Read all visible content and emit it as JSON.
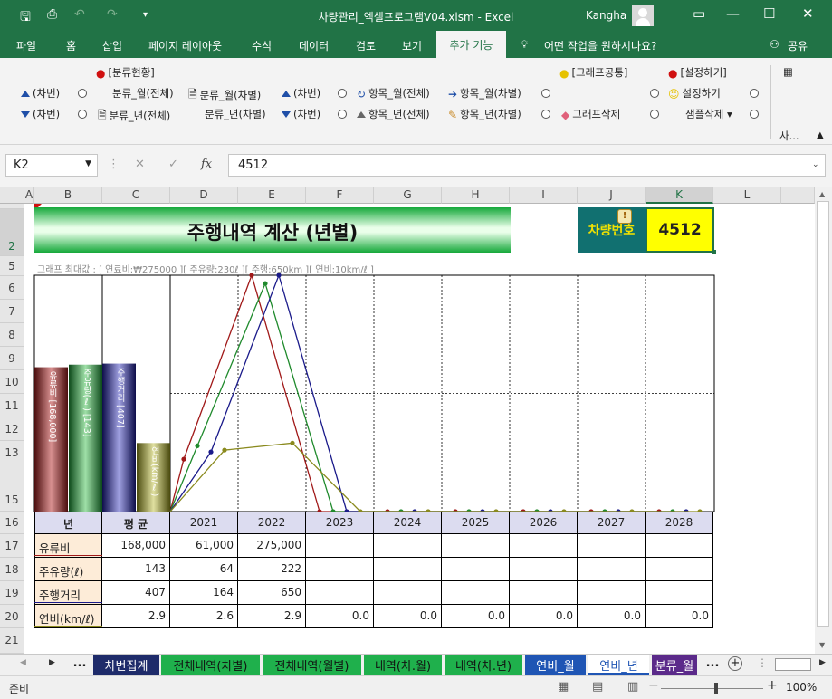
{
  "window": {
    "title": "차량관리_엑셀프로그램V04.xlsm  -  Excel",
    "user": "Kangha"
  },
  "ribbon_tabs": [
    "파일",
    "홈",
    "삽입",
    "페이지 레이아웃",
    "수식",
    "데이터",
    "검토",
    "보기",
    "추가 기능"
  ],
  "tell_me": "어떤 작업을 원하시나요?",
  "share": "공유",
  "ribbon": {
    "group1_title": "[분류현황]",
    "group2_title": "[그래프공통]",
    "group3_title": "[설정하기]",
    "col1": [
      "(차번)",
      "(차번)"
    ],
    "col2": [
      "분류_월(전체)",
      "분류_년(전체)"
    ],
    "col3": [
      "분류_월(차별)",
      "분류_년(차별)"
    ],
    "col4": [
      "(차번)",
      "(차번)"
    ],
    "col5": [
      "항목_월(전체)",
      "항목_년(전체)"
    ],
    "col6": [
      "항목_월(차별)",
      "항목_년(차별)"
    ],
    "col7": [
      "그래프삭제"
    ],
    "col8": [
      "설정하기",
      "샘플삭제"
    ],
    "collapsed": "사..."
  },
  "formula_bar": {
    "cell_ref": "K2",
    "fx": "fx",
    "value": "4512"
  },
  "columns": [
    "A",
    "B",
    "C",
    "D",
    "E",
    "F",
    "G",
    "H",
    "I",
    "J",
    "K",
    "L"
  ],
  "rows": [
    "1",
    "2",
    "5",
    "6",
    "7",
    "8",
    "9",
    "10",
    "11",
    "12",
    "13",
    "15",
    "16",
    "17",
    "18",
    "19",
    "20",
    "21"
  ],
  "sheet": {
    "title": "주행내역 계산 (년별)",
    "car_label": "차량번호",
    "car_number": "4512",
    "graph_note": "그래프 최대값 : [ 연료비:₩275000 ][ 주유량:230ℓ ][ 주행:650km ][ 연비:10km/ℓ ]",
    "bar_labels": [
      "유류비 [168,000]",
      "주유량(ℓ) [143]",
      "주행거리 [407]",
      "연비(km/ℓ)"
    ],
    "table_header": [
      "년",
      "평 균",
      "2021",
      "2022",
      "2023",
      "2024",
      "2025",
      "2026",
      "2027",
      "2028"
    ],
    "table_rows": [
      {
        "label": "유류비",
        "avg": "168,000",
        "vals": [
          "61,000",
          "275,000",
          "",
          "",
          "",
          "",
          "",
          ""
        ]
      },
      {
        "label": "주유량(ℓ)",
        "avg": "143",
        "vals": [
          "64",
          "222",
          "",
          "",
          "",
          "",
          "",
          ""
        ]
      },
      {
        "label": "주행거리",
        "avg": "407",
        "vals": [
          "164",
          "650",
          "",
          "",
          "",
          "",
          "",
          ""
        ]
      },
      {
        "label": "연비(km/ℓ)",
        "avg": "2.9",
        "vals": [
          "2.6",
          "2.9",
          "0.0",
          "0.0",
          "0.0",
          "0.0",
          "0.0",
          "0.0"
        ]
      }
    ]
  },
  "chart_data": {
    "type": "line",
    "categories": [
      "2021",
      "2022",
      "2023",
      "2024",
      "2025",
      "2026",
      "2027",
      "2028"
    ],
    "ylim": [
      0,
      1
    ],
    "series": [
      {
        "name": "유류비",
        "color": "#a01818",
        "values": [
          61000,
          275000,
          0,
          0,
          0,
          0,
          0,
          0
        ],
        "max": 275000
      },
      {
        "name": "주유량(ℓ)",
        "color": "#1f8a2c",
        "values": [
          64,
          222,
          0,
          0,
          0,
          0,
          0,
          0
        ],
        "max": 230
      },
      {
        "name": "주행거리",
        "color": "#1a1a8a",
        "values": [
          164,
          650,
          0,
          0,
          0,
          0,
          0,
          0
        ],
        "max": 650
      },
      {
        "name": "연비(km/ℓ)",
        "color": "#8a8a1e",
        "values": [
          2.6,
          2.9,
          0,
          0,
          0,
          0,
          0,
          0
        ],
        "max": 10
      }
    ],
    "averages": [
      168000,
      143,
      407,
      2.9
    ]
  },
  "sheet_tabs": [
    "...",
    "차번집계",
    "전체내역(차별)",
    "전체내역(월별)",
    "내역(차.월)",
    "내역(차.년)",
    "연비_월",
    "연비_년",
    "분류_월"
  ],
  "status": {
    "ready": "준비",
    "zoom": "100%"
  }
}
